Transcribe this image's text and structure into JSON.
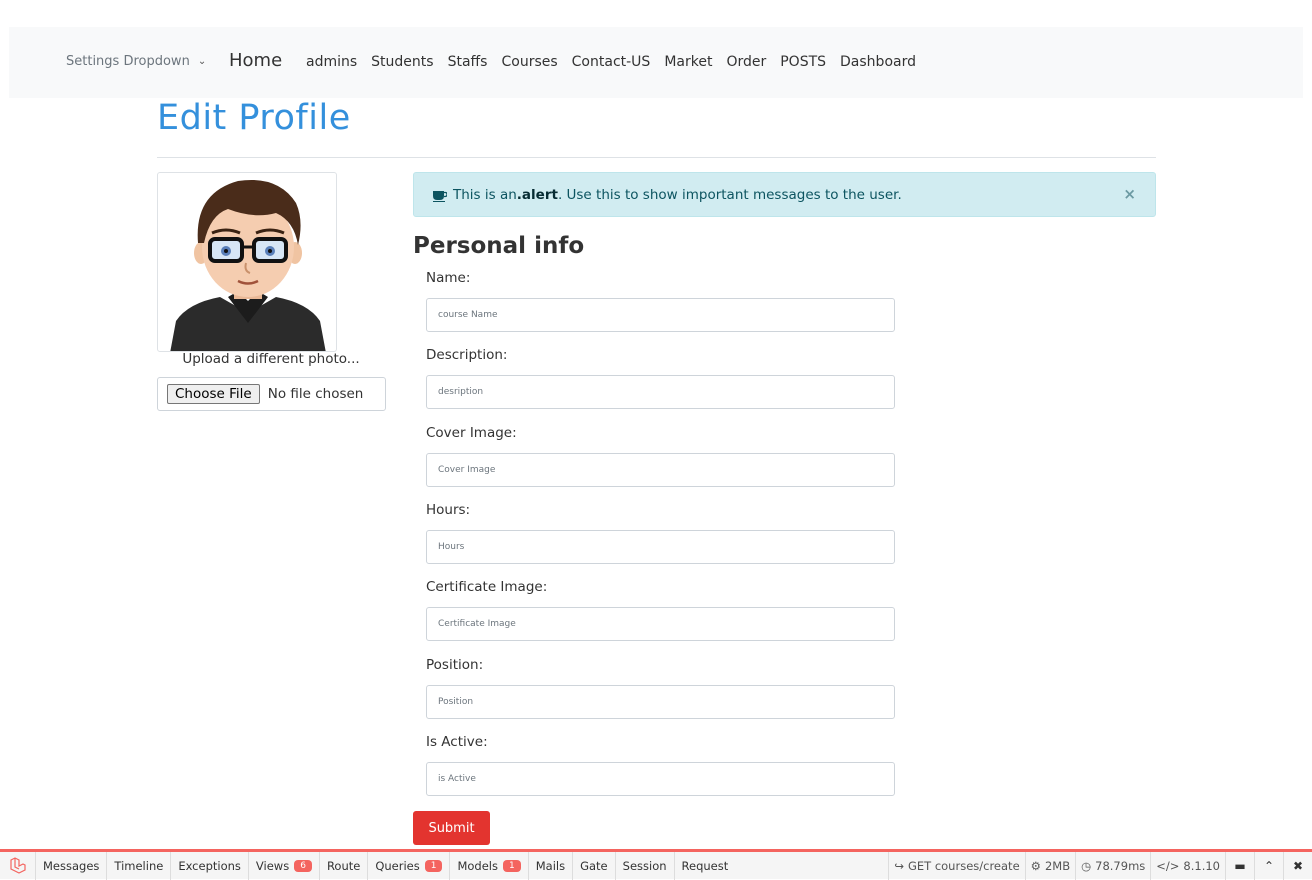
{
  "nav": {
    "dropdown_label": "Settings Dropdown",
    "home": "Home",
    "links": [
      "admins",
      "Students",
      "Staffs",
      "Courses",
      "Contact-US",
      "Market",
      "Order",
      "POSTS",
      "Dashboard"
    ]
  },
  "page": {
    "title": "Edit Profile",
    "upload_label": "Upload a different photo...",
    "file_button": "Choose File",
    "file_status": "No file chosen"
  },
  "alert": {
    "prefix": "This is an ",
    "strong": ".alert",
    "suffix": ". Use this to show important messages to the user.",
    "close": "×"
  },
  "form": {
    "section_title": "Personal info",
    "fields": [
      {
        "label": "Name:",
        "placeholder": "course Name"
      },
      {
        "label": "Description:",
        "placeholder": "desription"
      },
      {
        "label": "Cover Image:",
        "placeholder": "Cover Image"
      },
      {
        "label": "Hours:",
        "placeholder": "Hours"
      },
      {
        "label": "Certificate Image:",
        "placeholder": "Certificate Image"
      },
      {
        "label": "Position:",
        "placeholder": "Position"
      },
      {
        "label": "Is Active:",
        "placeholder": "is Active"
      }
    ],
    "submit": "Submit"
  },
  "debugbar": {
    "tabs": [
      {
        "label": "Messages"
      },
      {
        "label": "Timeline"
      },
      {
        "label": "Exceptions"
      },
      {
        "label": "Views",
        "badge": "6"
      },
      {
        "label": "Route"
      },
      {
        "label": "Queries",
        "badge": "1"
      },
      {
        "label": "Models",
        "badge": "1"
      },
      {
        "label": "Mails"
      },
      {
        "label": "Gate"
      },
      {
        "label": "Session"
      },
      {
        "label": "Request"
      }
    ],
    "route": "GET courses/create",
    "memory": "2MB",
    "time": "78.79ms",
    "version": "8.1.10"
  },
  "colors": {
    "accent": "#3490dc",
    "danger": "#e3342f",
    "alert_bg": "#d1ecf1",
    "debug_accent": "#f4645f"
  }
}
